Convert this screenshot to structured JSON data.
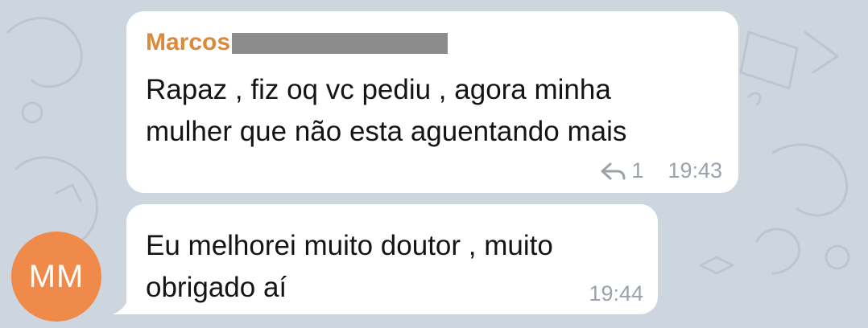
{
  "colors": {
    "background": "#cdd6df",
    "bubble": "#ffffff",
    "sender_name": "#d98a3a",
    "avatar": "#f08a4a",
    "meta_text": "#9aa2ab",
    "redaction": "#8c8c8c"
  },
  "messages": [
    {
      "sender": "Marcos",
      "sender_redacted": true,
      "text": "Rapaz , fiz oq vc pediu , agora minha\nmulher que não esta aguentando mais",
      "reply_icon": "reply-arrow-icon",
      "reply_count": "1",
      "time": "19:43"
    },
    {
      "text": "Eu melhorei muito doutor , muito\nobrigado aí",
      "time": "19:44"
    }
  ],
  "avatar": {
    "initials": "MM"
  }
}
